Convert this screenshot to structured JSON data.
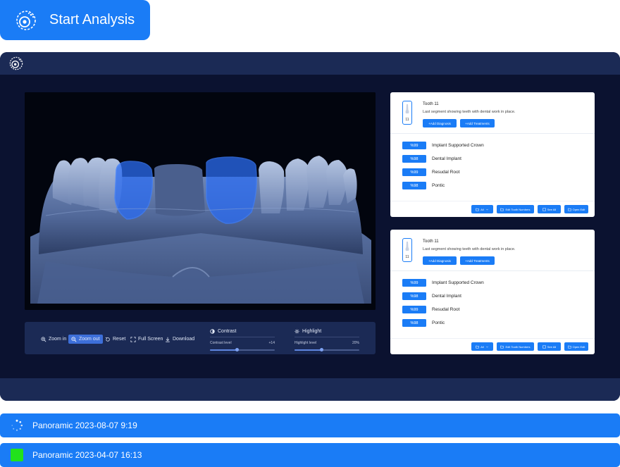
{
  "start_button": {
    "label": "Start Analysis"
  },
  "controls": {
    "zoom_in": "Zoom in",
    "zoom_out": "Zoom out",
    "reset": "Reset",
    "full_screen": "Full Screen",
    "download": "Download",
    "contrast": {
      "title": "Contrast",
      "label": "Contrast level",
      "value_text": "+14",
      "level": 0.42
    },
    "highlight": {
      "title": "Highlight",
      "label": "Highlight level",
      "value_text": "20%",
      "level": 0.42
    }
  },
  "cards": [
    {
      "tooth_number": "11",
      "title": "Tooth 11",
      "description": "Last segment showing teeth with dental work in place.",
      "add_diagnosis": "+Add Diagnosis",
      "add_treatments": "+Add Treatments",
      "diagnoses": [
        {
          "badge": "%99",
          "label": "Implant Supported Crown"
        },
        {
          "badge": "%98",
          "label": "Dental Implant"
        },
        {
          "badge": "%99",
          "label": "Resudal Root"
        },
        {
          "badge": "%98",
          "label": "Pontic"
        }
      ],
      "footer": {
        "all": "All",
        "edit_tooth_numbers": "Edit Tooth Numbers",
        "see_all": "See All",
        "open_edit": "Open Edit"
      }
    },
    {
      "tooth_number": "11",
      "title": "Tooth 11",
      "description": "Last segment showing teeth with dental work in place.",
      "add_diagnosis": "+Add Diagnosis",
      "add_treatments": "+Add Treatments",
      "diagnoses": [
        {
          "badge": "%99",
          "label": "Implant Supported Crown"
        },
        {
          "badge": "%98",
          "label": "Dental Implant"
        },
        {
          "badge": "%99",
          "label": "Resudal Root"
        },
        {
          "badge": "%98",
          "label": "Pontic"
        }
      ],
      "footer": {
        "all": "All",
        "edit_tooth_numbers": "Edit Tooth Numbers",
        "see_all": "See All",
        "open_edit": "Open Edit"
      }
    }
  ],
  "scans": [
    {
      "label": "Panoramic 2023-08-07 9:19",
      "status": "loading"
    },
    {
      "label": "Panoramic 2023-04-07 16:13",
      "status": "ready"
    }
  ],
  "colors": {
    "accent": "#1a7cf6",
    "window_bg": "#0b1230",
    "panel": "#1b2a55",
    "ready": "#22e21c",
    "highlight_overlay": "#2b6cf2"
  }
}
